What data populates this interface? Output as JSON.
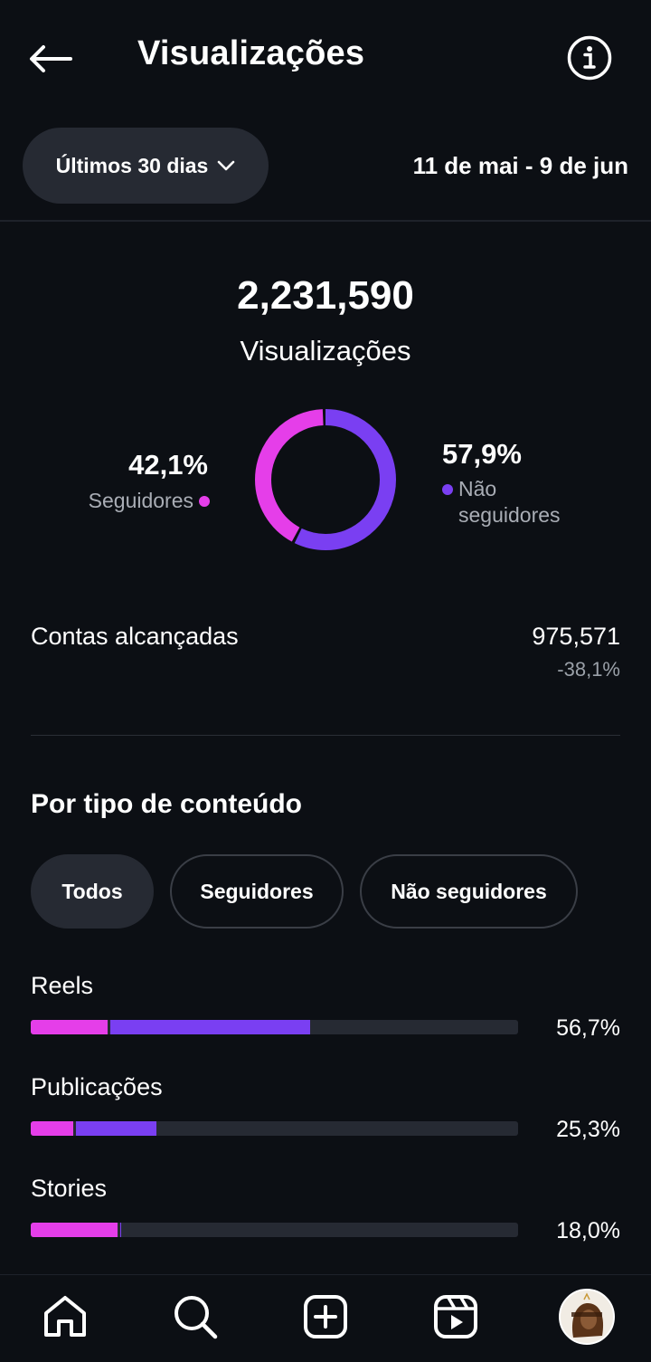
{
  "header": {
    "title": "Visualizações"
  },
  "period": {
    "selector_label": "Últimos 30 dias",
    "date_range": "11 de mai - 9 de jun"
  },
  "summary": {
    "total_views": "2,231,590",
    "total_label": "Visualizações",
    "followers_pct": "42,1%",
    "followers_label": "Seguidores",
    "followers_fraction": 0.421,
    "non_followers_pct": "57,9%",
    "non_followers_label_line1": "Não",
    "non_followers_label_line2": "seguidores",
    "non_followers_fraction": 0.579
  },
  "reach": {
    "label": "Contas alcançadas",
    "value": "975,571",
    "change": "-38,1%"
  },
  "content_type": {
    "title": "Por tipo de conteúdo",
    "filters": [
      "Todos",
      "Seguidores",
      "Não seguidores"
    ],
    "active_filter": "Todos",
    "rows": [
      {
        "label": "Reels",
        "pct": "56,7%",
        "followers_share": 0.158,
        "non_followers_share": 0.409
      },
      {
        "label": "Publicações",
        "pct": "25,3%",
        "followers_share": 0.088,
        "non_followers_share": 0.165
      },
      {
        "label": "Stories",
        "pct": "18,0%",
        "followers_share": 0.178,
        "non_followers_share": 0.002
      }
    ]
  },
  "colors": {
    "followers": "#e53ee9",
    "non_followers": "#7a3ff2",
    "background": "#0c0f14",
    "pill": "#262a33"
  },
  "nav": {
    "items": [
      "home-icon",
      "search-icon",
      "create-icon",
      "reels-icon",
      "profile-avatar"
    ]
  }
}
